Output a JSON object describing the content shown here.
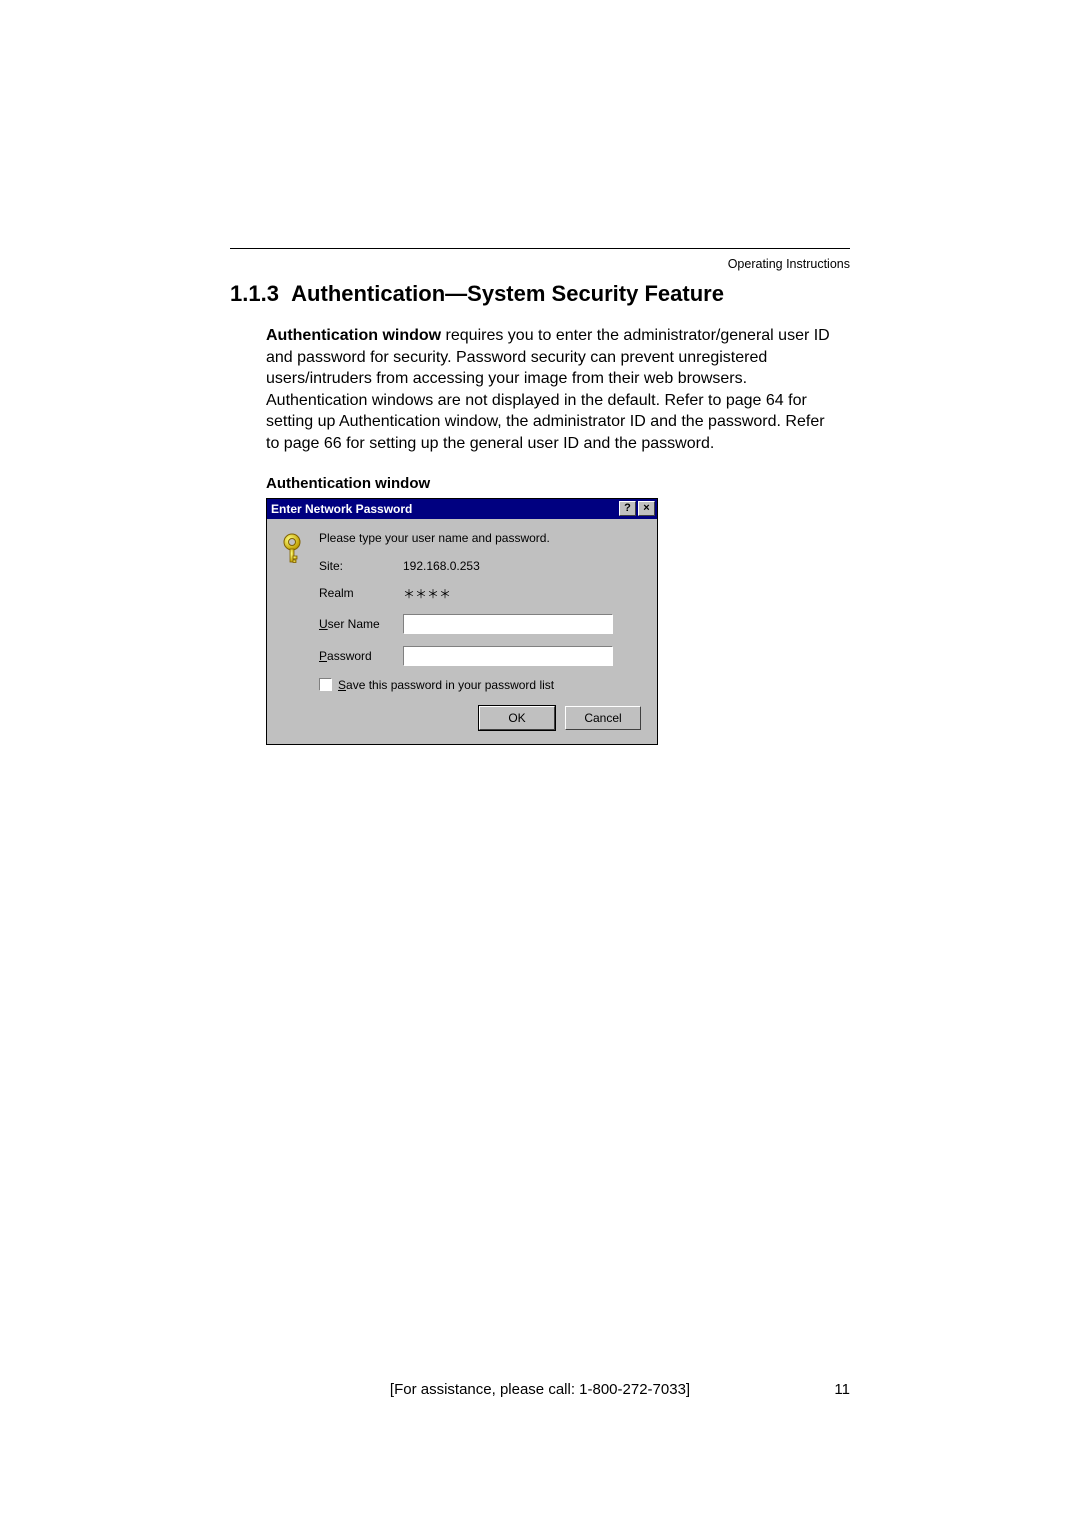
{
  "header": {
    "running": "Operating Instructions"
  },
  "section": {
    "number": "1.1.3",
    "title": "Authentication—System Security Feature"
  },
  "para": {
    "lead_bold": "Authentication window",
    "rest": " requires you to enter the administrator/general user ID and password for security. Password security can prevent unregistered users/intruders from accessing your image from their web browsers. Authentication windows are not displayed in the default. Refer to page 64 for setting up Authentication window, the administrator ID and the password. Refer to page 66 for setting up the general user ID and the password."
  },
  "subhead": "Authentication window",
  "dialog": {
    "title": "Enter Network Password",
    "help_btn": "?",
    "close_btn": "×",
    "prompt": "Please type your user name and password.",
    "rows": {
      "site_label": "Site:",
      "site_value": "192.168.0.253",
      "realm_label": "Realm",
      "realm_value": "＊＊＊＊",
      "user_label_pre": "U",
      "user_label_rest": "ser Name",
      "user_value": "",
      "pass_label_pre": "P",
      "pass_label_rest": "assword",
      "pass_value": ""
    },
    "save_checkbox": {
      "pre": "S",
      "rest": "ave this password in your password list"
    },
    "ok": "OK",
    "cancel": "Cancel"
  },
  "footer": {
    "assist": "[For assistance, please call: 1-800-272-7033]",
    "page": "11"
  }
}
